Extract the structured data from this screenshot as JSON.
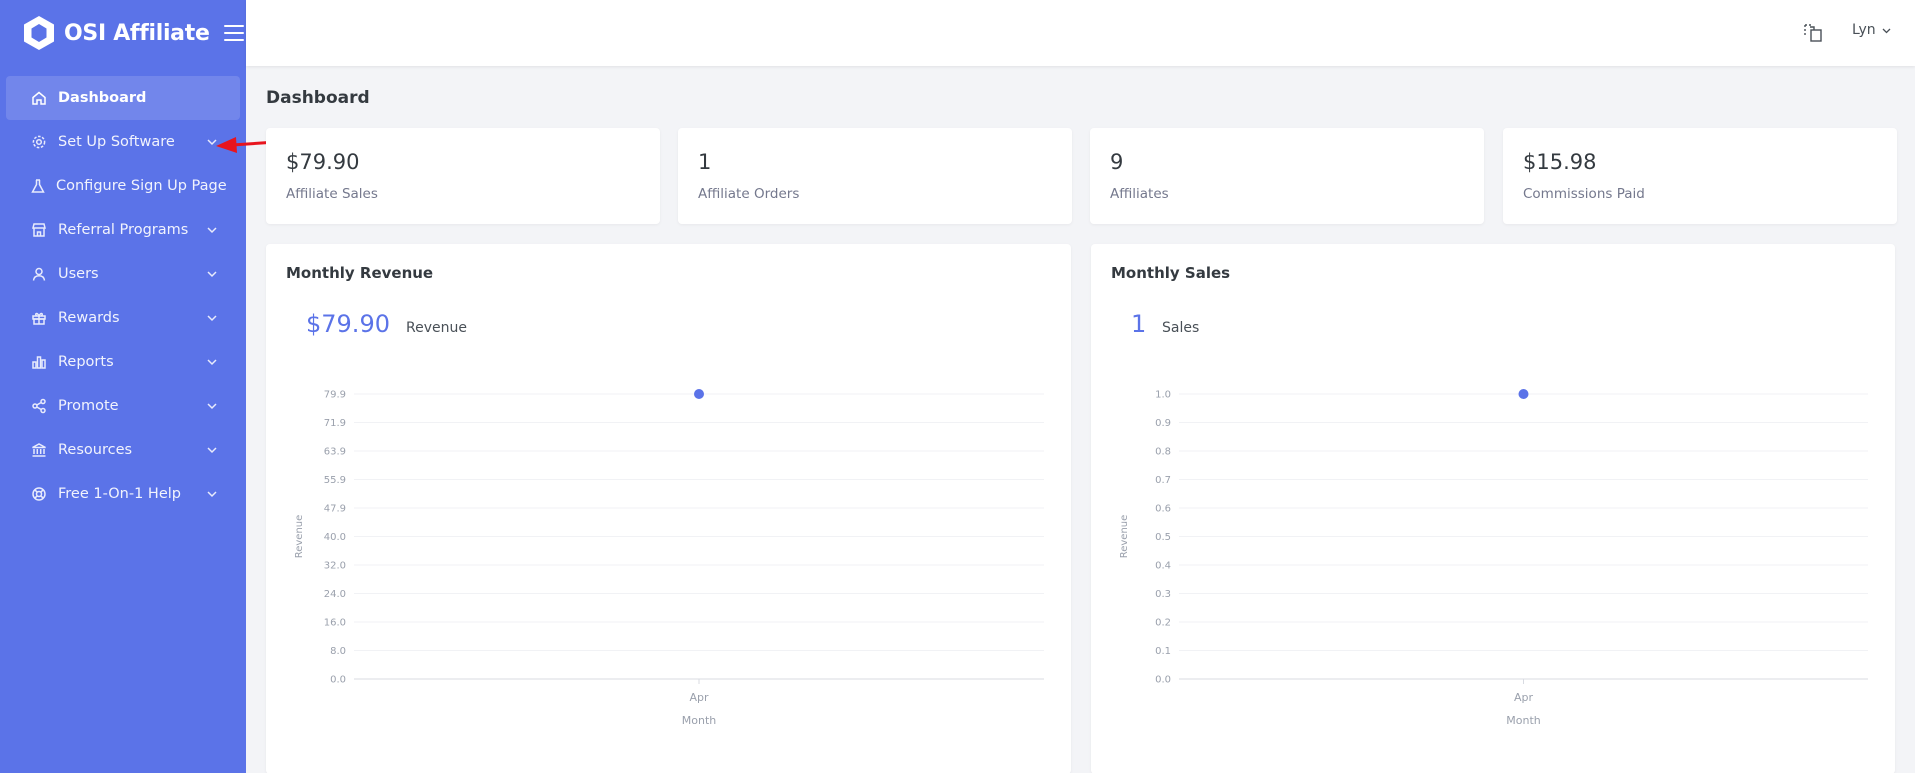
{
  "brand": {
    "name": "OSI Affiliate"
  },
  "sidebar": {
    "items": [
      {
        "label": "Dashboard",
        "icon": "home-icon",
        "active": true,
        "has_children": false
      },
      {
        "label": "Set Up Software",
        "icon": "gear-icon",
        "active": false,
        "has_children": true
      },
      {
        "label": "Configure Sign Up Page",
        "icon": "flask-icon",
        "active": false,
        "has_children": false
      },
      {
        "label": "Referral Programs",
        "icon": "store-icon",
        "active": false,
        "has_children": true
      },
      {
        "label": "Users",
        "icon": "user-icon",
        "active": false,
        "has_children": true
      },
      {
        "label": "Rewards",
        "icon": "gift-icon",
        "active": false,
        "has_children": true
      },
      {
        "label": "Reports",
        "icon": "bar-chart-icon",
        "active": false,
        "has_children": true
      },
      {
        "label": "Promote",
        "icon": "share-icon",
        "active": false,
        "has_children": true
      },
      {
        "label": "Resources",
        "icon": "bank-icon",
        "active": false,
        "has_children": true
      },
      {
        "label": "Free 1-On-1 Help",
        "icon": "lifebuoy-icon",
        "active": false,
        "has_children": true
      }
    ]
  },
  "header": {
    "user_name": "Lyn"
  },
  "page": {
    "title": "Dashboard"
  },
  "stats": [
    {
      "value": "$79.90",
      "label": "Affiliate Sales"
    },
    {
      "value": "1",
      "label": "Affiliate Orders"
    },
    {
      "value": "9",
      "label": "Affiliates"
    },
    {
      "value": "$15.98",
      "label": "Commissions Paid"
    }
  ],
  "colors": {
    "primary": "#5b73e8",
    "point": "#5b73e8",
    "arrow": "#e8141e"
  },
  "chart_data": [
    {
      "type": "scatter",
      "title": "Monthly Revenue",
      "headline_value": "$79.90",
      "headline_label": "Revenue",
      "xlabel": "Month",
      "ylabel": "Revenue",
      "categories": [
        "Apr"
      ],
      "values": [
        79.9
      ],
      "yticks": [
        "0.0",
        "8.0",
        "16.0",
        "24.0",
        "32.0",
        "40.0",
        "47.9",
        "55.9",
        "63.9",
        "71.9",
        "79.9"
      ],
      "ylim": [
        0,
        79.9
      ]
    },
    {
      "type": "scatter",
      "title": "Monthly Sales",
      "headline_value": "1",
      "headline_label": "Sales",
      "xlabel": "Month",
      "ylabel": "Revenue",
      "categories": [
        "Apr"
      ],
      "values": [
        1
      ],
      "yticks": [
        "0.0",
        "0.1",
        "0.2",
        "0.3",
        "0.4",
        "0.5",
        "0.6",
        "0.7",
        "0.8",
        "0.9",
        "1.0"
      ],
      "ylim": [
        0,
        1
      ]
    }
  ]
}
